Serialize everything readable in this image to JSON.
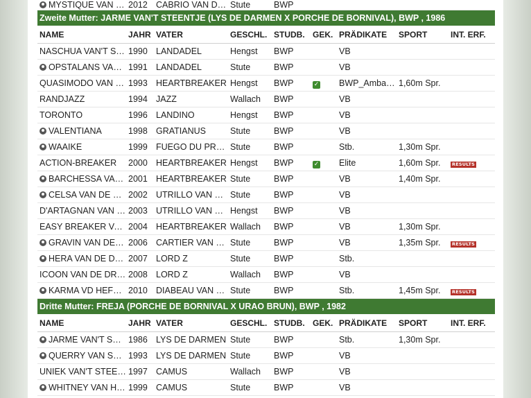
{
  "top_row": {
    "name": "MYSTIQUE VAN DE ...",
    "mare": true,
    "year": "2012",
    "vater": "CABRIO VAN DE ...",
    "sex": "Stute",
    "stud": "BWP"
  },
  "section2": {
    "title": "Zweite Mutter: JARME VAN'T STEENTJE (LYS DE DARMEN X PORCHE DE BORNIVAL), BWP , 1986",
    "rows": [
      {
        "name": "NASCHUA VAN'T STEE...",
        "mare": false,
        "year": "1990",
        "vater": "LANDADEL",
        "sex": "Hengst",
        "stud": "BWP",
        "gek": false,
        "pr": "VB",
        "sport": "",
        "results": false
      },
      {
        "name": "OPSTALANS VAN H...",
        "mare": true,
        "year": "1991",
        "vater": "LANDADEL",
        "sex": "Stute",
        "stud": "BWP",
        "gek": false,
        "pr": "VB",
        "sport": "",
        "results": false
      },
      {
        "name": "QUASIMODO VAN DE ...",
        "mare": false,
        "year": "1993",
        "vater": "HEARTBREAKER",
        "sex": "Hengst",
        "stud": "BWP",
        "gek": true,
        "pr": "BWP_Ambass...",
        "sport": "1,60m Spr.",
        "results": false
      },
      {
        "name": "RANDJAZZ",
        "mare": false,
        "year": "1994",
        "vater": "JAZZ",
        "sex": "Wallach",
        "stud": "BWP",
        "gek": false,
        "pr": "VB",
        "sport": "",
        "results": false
      },
      {
        "name": "TORONTO",
        "mare": false,
        "year": "1996",
        "vater": "LANDINO",
        "sex": "Hengst",
        "stud": "BWP",
        "gek": false,
        "pr": "VB",
        "sport": "",
        "results": false
      },
      {
        "name": "VALENTIANA",
        "mare": true,
        "year": "1998",
        "vater": "GRATIANUS",
        "sex": "Stute",
        "stud": "BWP",
        "gek": false,
        "pr": "VB",
        "sport": "",
        "results": false
      },
      {
        "name": "WAAIKE",
        "mare": true,
        "year": "1999",
        "vater": "FUEGO DU PRELET",
        "sex": "Stute",
        "stud": "BWP",
        "gek": false,
        "pr": "Stb.",
        "sport": "1,30m Spr.",
        "results": false
      },
      {
        "name": "ACTION-BREAKER",
        "mare": false,
        "year": "2000",
        "vater": "HEARTBREAKER",
        "sex": "Hengst",
        "stud": "BWP",
        "gek": true,
        "pr": "Elite",
        "sport": "1,60m Spr.",
        "results": true
      },
      {
        "name": "BARCHESSA VAN DE...",
        "mare": true,
        "year": "2001",
        "vater": "HEARTBREAKER",
        "sex": "Stute",
        "stud": "BWP",
        "gek": false,
        "pr": "VB",
        "sport": "1,40m Spr.",
        "results": false
      },
      {
        "name": "CELSA VAN DE DRE...",
        "mare": true,
        "year": "2002",
        "vater": "UTRILLO VAN DE ...",
        "sex": "Stute",
        "stud": "BWP",
        "gek": false,
        "pr": "VB",
        "sport": "",
        "results": false
      },
      {
        "name": "D'ARTAGNAN VAN DE...",
        "mare": false,
        "year": "2003",
        "vater": "UTRILLO VAN DE ...",
        "sex": "Hengst",
        "stud": "BWP",
        "gek": false,
        "pr": "VB",
        "sport": "",
        "results": false
      },
      {
        "name": "EASY BREAKER VAN D...",
        "mare": false,
        "year": "2004",
        "vater": "HEARTBREAKER",
        "sex": "Wallach",
        "stud": "BWP",
        "gek": false,
        "pr": "VB",
        "sport": "1,30m Spr.",
        "results": false
      },
      {
        "name": "GRAVIN VAN DE DR...",
        "mare": true,
        "year": "2006",
        "vater": "CARTIER VAN DE ...",
        "sex": "Stute",
        "stud": "BWP",
        "gek": false,
        "pr": "VB",
        "sport": "1,35m Spr.",
        "results": true
      },
      {
        "name": "HERA VAN DE DREEF",
        "mare": true,
        "year": "2007",
        "vater": "LORD Z",
        "sex": "Stute",
        "stud": "BWP",
        "gek": false,
        "pr": "Stb.",
        "sport": "",
        "results": false
      },
      {
        "name": "ICOON VAN DE DREEF",
        "mare": false,
        "year": "2008",
        "vater": "LORD Z",
        "sex": "Wallach",
        "stud": "BWP",
        "gek": false,
        "pr": "VB",
        "sport": "",
        "results": false
      },
      {
        "name": "KARMA VD HEFFINCK",
        "mare": true,
        "year": "2010",
        "vater": "DIABEAU VAN DE ...",
        "sex": "Stute",
        "stud": "BWP",
        "gek": false,
        "pr": "Stb.",
        "sport": "1,45m Spr.",
        "results": true
      }
    ]
  },
  "section3": {
    "title": "Dritte Mutter: FREJA (PORCHE DE BORNIVAL X URAO BRUN), BWP , 1982",
    "rows": [
      {
        "name": "JARME VAN'T STEE...",
        "mare": true,
        "year": "1986",
        "vater": "LYS DE DARMEN",
        "sex": "Stute",
        "stud": "BWP",
        "gek": false,
        "pr": "Stb.",
        "sport": "1,30m Spr.",
        "results": false
      },
      {
        "name": "QUERRY VAN STEE...",
        "mare": true,
        "year": "1993",
        "vater": "LYS DE DARMEN",
        "sex": "Stute",
        "stud": "BWP",
        "gek": false,
        "pr": "VB",
        "sport": "",
        "results": false
      },
      {
        "name": "UNIEK VAN'T STEENTJE",
        "mare": false,
        "year": "1997",
        "vater": "CAMUS",
        "sex": "Wallach",
        "stud": "BWP",
        "gek": false,
        "pr": "VB",
        "sport": "",
        "results": false
      },
      {
        "name": "WHITNEY VAN HET ...",
        "mare": true,
        "year": "1999",
        "vater": "CAMUS",
        "sex": "Stute",
        "stud": "BWP",
        "gek": false,
        "pr": "VB",
        "sport": "",
        "results": false
      }
    ]
  },
  "columns": {
    "name": "NAME",
    "year": "JAHR",
    "vater": "VATER",
    "sex": "GESCHL.",
    "stud": "STUDB.",
    "gek": "GEK.",
    "pr": "PRÄDIKATE",
    "sport": "SPORT",
    "int": "INT. ERF."
  },
  "labels": {
    "results": "RESULTS",
    "check": "✓"
  },
  "colors": {
    "section_bg": "#3f7a32",
    "results_bg": "#b5322a",
    "check_bg": "#3f8c2f"
  }
}
